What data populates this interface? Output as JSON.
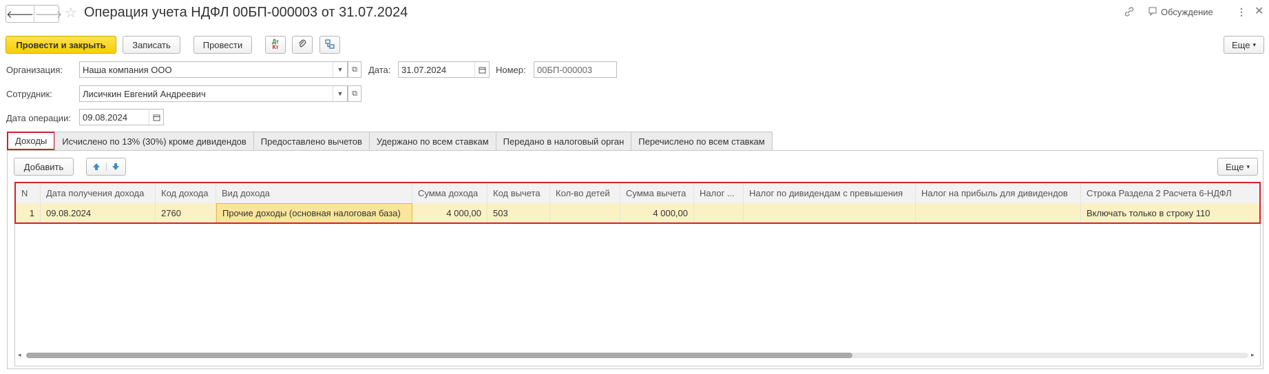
{
  "window": {
    "title": "Операция учета НДФЛ 00БП-000003 от 31.07.2024",
    "discussion_label": "Обсуждение"
  },
  "toolbar": {
    "post_close_label": "Провести и закрыть",
    "save_label": "Записать",
    "post_label": "Провести",
    "dtkt_dt": "Дт",
    "dtkt_kt": "Кт",
    "more_label": "Еще"
  },
  "form": {
    "organization_label": "Организация:",
    "organization_value": "Наша компания ООО",
    "date_label": "Дата:",
    "date_value": "31.07.2024",
    "number_label": "Номер:",
    "number_value": "00БП-000003",
    "employee_label": "Сотрудник:",
    "employee_value": "Лисичкин Евгений Андреевич",
    "op_date_label": "Дата операции:",
    "op_date_value": "09.08.2024"
  },
  "tabs": [
    {
      "label": "Доходы",
      "active": true
    },
    {
      "label": "Исчислено по 13% (30%) кроме дивидендов"
    },
    {
      "label": "Предоставлено вычетов"
    },
    {
      "label": "Удержано по всем ставкам"
    },
    {
      "label": "Передано в налоговый орган"
    },
    {
      "label": "Перечислено по всем ставкам"
    }
  ],
  "table_toolbar": {
    "add_label": "Добавить",
    "more_label": "Еще"
  },
  "table": {
    "columns": [
      "N",
      "Дата получения дохода",
      "Код дохода",
      "Вид дохода",
      "Сумма дохода",
      "Код вычета",
      "Кол-во детей",
      "Сумма вычета",
      "Налог ...",
      "Налог по дивидендам с превышения",
      "Налог на прибыль для дивидендов",
      "Строка Раздела 2 Расчета 6-НДФЛ"
    ],
    "rows": [
      {
        "n": "1",
        "date": "09.08.2024",
        "code": "2760",
        "kind": "Прочие доходы (основная налоговая база)",
        "amount": "4 000,00",
        "deduction_code": "503",
        "children": "",
        "deduction_amount": "4 000,00",
        "tax": "",
        "div_tax": "",
        "profit_tax": "",
        "section_line": "Включать только в строку 110"
      }
    ]
  },
  "colors": {
    "accent": "#f9cf00",
    "highlight": "#d0202d",
    "row_selected": "#fbf1c5"
  }
}
